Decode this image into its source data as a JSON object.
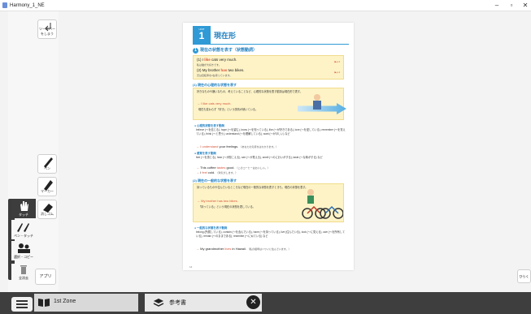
{
  "window": {
    "title": "Harmony_1_NE"
  },
  "toolbar": {
    "back_label": "ツールバーをしまう",
    "pen_label": "ペン",
    "marker_label": "マーカー",
    "eraser_label": "消しゴム",
    "touch_label": "タッチ",
    "pentouch_label": "ペン・タッチ",
    "select_label": "選択・コピー",
    "trash_label": "全消去",
    "app_label": "アプリ"
  },
  "page": {
    "unit_label": "UNIT",
    "unit_number": "1",
    "unit_title": "現在形",
    "section1_num": "1",
    "section1_title": "現在の状態を表す（状態動詞）",
    "ex1_prefix": "(1) I ",
    "ex1_verb": "like",
    "ex1_rest": " cats very much.",
    "ex1_jp": "私は猫が大好きです。",
    "ex1_ref": "▶p.4",
    "ex2_prefix": "(2) My brother ",
    "ex2_verb": "has",
    "ex2_rest": " two bikes.",
    "ex2_jp": "兄は自転車を2台持っています。",
    "ex2_ref": "▶p.4",
    "sub1_title": "(1) 現在の心理的な状態を表す",
    "para1": "好きなものや嫌いなもの、考えていることなど、心理的な状態を表す動詞は現在形で表す。",
    "sub1_ex": "→ I like cats very much.",
    "sub1_ex_jp": "現在も変わらず「好き」という感情が続いている。",
    "bullet1_h": "● 心理的状態を表す動詞",
    "para2": "believe (～を信じる), hope (～を望む), know (～を知っている), like (～が好きである), love (～を愛している), remember (～を覚えている), think (～と思う), understand (～を理解している), want (～がほしい) など",
    "bullet1_ex_verb": "I understand",
    "bullet1_ex_rest": " your feelings.",
    "bullet1_ex_jp": "（あなたの気持ちはわかります。）",
    "bullet2_h": "● 感覚を表す動詞",
    "para3": "feel (～を感じる), hear (～が聞こえる), see (～が見える), smell (～のにおいがする), taste (～な味がする) など",
    "bullet2_ex1_pre": "This coffee ",
    "bullet2_ex1_verb": "tastes",
    "bullet2_ex1_rest": " good.",
    "bullet2_ex1_jp": "（このコーヒーはおいしい。）",
    "bullet2_ex2_pre": "I ",
    "bullet2_ex2_verb": "feel",
    "bullet2_ex2_rest": " cold.",
    "bullet2_ex2_jp": "（寒気がします。）",
    "sub2_title": "(2) 現在の一般的な状態を表す",
    "para4": "持っているものや住んでいるところなど現在の一般的な状態を表すときも、現在の状態を表す。",
    "sub2_ex": "→ My brother has two bikes.",
    "sub2_ex_jp": "「持っている」という現在の状態を表している。",
    "bullet3_h": "● 一般的な状態を表す動詞",
    "para5": "belong (所属している), contain (～を含んでいる), have (～を持っている), live (住んでいる), look (～に見える), own (～を所有している), remain (～のままである), resemble (～に似ている) など",
    "bullet3_ex_pre": "My grandmother ",
    "bullet3_ex_verb": "lives",
    "bullet3_ex_rest": " in Hawaii.",
    "bullet3_ex_jp": "（私の祖母はハワイに住んでいます。）",
    "page_number": "14"
  },
  "bottom": {
    "tab1_label": "1st Zone",
    "tab2_label": "参考書"
  },
  "right_button_label": "ひらく"
}
